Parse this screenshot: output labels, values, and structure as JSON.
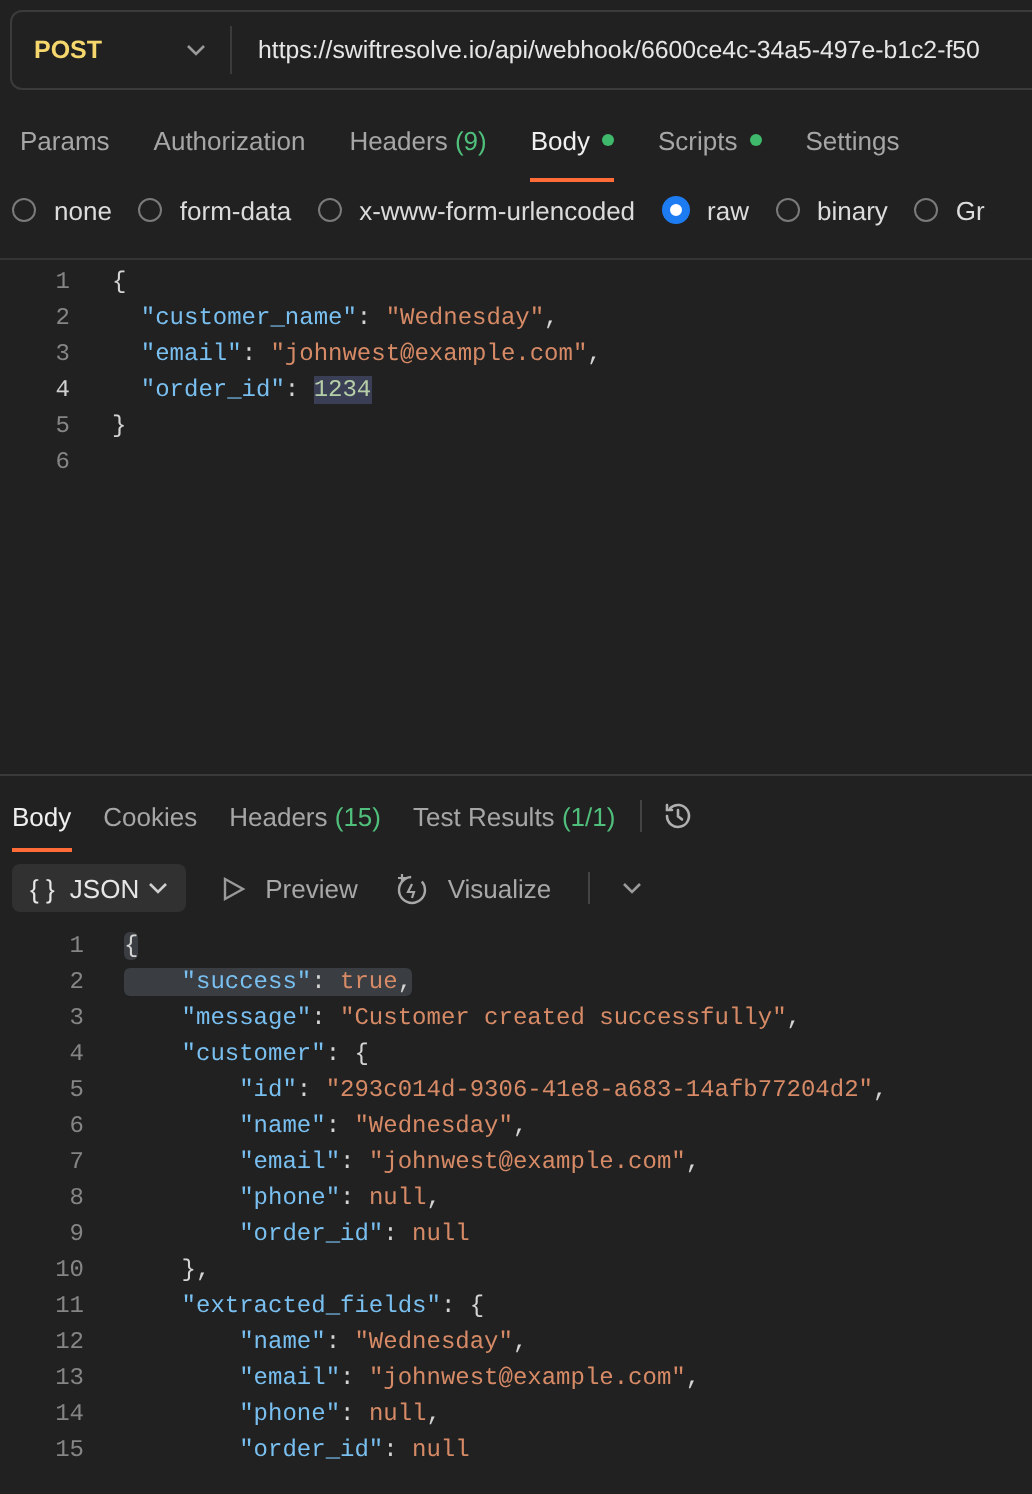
{
  "request_bar": {
    "method": "POST",
    "url": "https://swiftresolve.io/api/webhook/6600ce4c-34a5-497e-b1c2-f50"
  },
  "request_tabs": [
    {
      "label": "Params",
      "dot": false,
      "selected": false
    },
    {
      "label": "Authorization",
      "dot": false,
      "selected": false
    },
    {
      "label": "Headers",
      "count": "(9)",
      "dot": false,
      "selected": false
    },
    {
      "label": "Body",
      "dot": true,
      "selected": true
    },
    {
      "label": "Scripts",
      "dot": true,
      "selected": false
    },
    {
      "label": "Settings",
      "dot": false,
      "selected": false
    }
  ],
  "body_types": [
    {
      "label": "none",
      "selected": false
    },
    {
      "label": "form-data",
      "selected": false
    },
    {
      "label": "x-www-form-urlencoded",
      "selected": false
    },
    {
      "label": "raw",
      "selected": true
    },
    {
      "label": "binary",
      "selected": false
    },
    {
      "label": "Gr",
      "selected": false
    }
  ],
  "request_editor": {
    "lines": [
      {
        "number": "1",
        "selected": false,
        "tokens": [
          {
            "kind": "punct",
            "text": "{"
          }
        ]
      },
      {
        "number": "2",
        "selected": false,
        "tokens": [
          {
            "kind": "key",
            "text": "  \"customer_name\""
          },
          {
            "kind": "punct",
            "text": ": "
          },
          {
            "kind": "string",
            "text": "\"Wednesday\""
          },
          {
            "kind": "punct",
            "text": ","
          }
        ]
      },
      {
        "number": "3",
        "selected": false,
        "tokens": [
          {
            "kind": "key",
            "text": "  \"email\""
          },
          {
            "kind": "punct",
            "text": ": "
          },
          {
            "kind": "string",
            "text": "\"johnwest@example.com\""
          },
          {
            "kind": "punct",
            "text": ","
          }
        ]
      },
      {
        "number": "4",
        "selected": true,
        "tokens": [
          {
            "kind": "key",
            "text": "  \"order_id\""
          },
          {
            "kind": "punct",
            "text": ": "
          },
          {
            "kind": "number",
            "text": "1234"
          }
        ]
      },
      {
        "number": "5",
        "selected": false,
        "tokens": [
          {
            "kind": "punct",
            "text": "}"
          }
        ]
      },
      {
        "number": "6",
        "selected": false
      }
    ]
  },
  "response_tabs": [
    {
      "label": "Body",
      "selected": true
    },
    {
      "label": "Cookies",
      "selected": false
    },
    {
      "label": "Headers",
      "count": "(15)",
      "selected": false
    },
    {
      "label": "Test Results",
      "count": "(1/1)",
      "selected": false
    }
  ],
  "response_toolbar": {
    "format": {
      "icon": "{ }",
      "label": "JSON"
    },
    "preview": "Preview",
    "visualize": "Visualize"
  },
  "response_editor": {
    "lines": [
      {
        "number": "1",
        "selected": true,
        "tokens": [
          {
            "kind": "punct",
            "text": "{"
          }
        ]
      },
      {
        "number": "2",
        "selected": true,
        "tokens": [
          {
            "kind": "key",
            "text": "    \"success\""
          },
          {
            "kind": "punct",
            "text": ": "
          },
          {
            "kind": "bool",
            "text": "true"
          },
          {
            "kind": "punct",
            "text": ","
          }
        ]
      },
      {
        "number": "3",
        "selected": false,
        "tokens": [
          {
            "kind": "key",
            "text": "    \"message\""
          },
          {
            "kind": "punct",
            "text": ": "
          },
          {
            "kind": "string",
            "text": "\"Customer created successfully\""
          },
          {
            "kind": "punct",
            "text": ","
          }
        ]
      },
      {
        "number": "4",
        "selected": false,
        "tokens": [
          {
            "kind": "key",
            "text": "    \"customer\""
          },
          {
            "kind": "punct",
            "text": ": {"
          }
        ]
      },
      {
        "number": "5",
        "selected": false,
        "tokens": [
          {
            "kind": "key",
            "text": "        \"id\""
          },
          {
            "kind": "punct",
            "text": ": "
          },
          {
            "kind": "string",
            "text": "\"293c014d-9306-41e8-a683-14afb77204d2\""
          },
          {
            "kind": "punct",
            "text": ","
          }
        ]
      },
      {
        "number": "6",
        "selected": false,
        "tokens": [
          {
            "kind": "key",
            "text": "        \"name\""
          },
          {
            "kind": "punct",
            "text": ": "
          },
          {
            "kind": "string",
            "text": "\"Wednesday\""
          },
          {
            "kind": "punct",
            "text": ","
          }
        ]
      },
      {
        "number": "7",
        "selected": false,
        "tokens": [
          {
            "kind": "key",
            "text": "        \"email\""
          },
          {
            "kind": "punct",
            "text": ": "
          },
          {
            "kind": "string",
            "text": "\"johnwest@example.com\""
          },
          {
            "kind": "punct",
            "text": ","
          }
        ]
      },
      {
        "number": "8",
        "selected": false,
        "tokens": [
          {
            "kind": "key",
            "text": "        \"phone\""
          },
          {
            "kind": "punct",
            "text": ": "
          },
          {
            "kind": "null",
            "text": "null"
          },
          {
            "kind": "punct",
            "text": ","
          }
        ]
      },
      {
        "number": "9",
        "selected": false,
        "tokens": [
          {
            "kind": "key",
            "text": "        \"order_id\""
          },
          {
            "kind": "punct",
            "text": ": "
          },
          {
            "kind": "null",
            "text": "null"
          }
        ]
      },
      {
        "number": "10",
        "selected": false,
        "tokens": [
          {
            "kind": "punct",
            "text": "    },"
          }
        ]
      },
      {
        "number": "11",
        "selected": false,
        "tokens": [
          {
            "kind": "key",
            "text": "    \"extracted_fields\""
          },
          {
            "kind": "punct",
            "text": ": {"
          }
        ]
      },
      {
        "number": "12",
        "selected": false,
        "tokens": [
          {
            "kind": "key",
            "text": "        \"name\""
          },
          {
            "kind": "punct",
            "text": ": "
          },
          {
            "kind": "string",
            "text": "\"Wednesday\""
          },
          {
            "kind": "punct",
            "text": ","
          }
        ]
      },
      {
        "number": "13",
        "selected": false,
        "tokens": [
          {
            "kind": "key",
            "text": "        \"email\""
          },
          {
            "kind": "punct",
            "text": ": "
          },
          {
            "kind": "string",
            "text": "\"johnwest@example.com\""
          },
          {
            "kind": "punct",
            "text": ","
          }
        ]
      },
      {
        "number": "14",
        "selected": false,
        "tokens": [
          {
            "kind": "key",
            "text": "        \"phone\""
          },
          {
            "kind": "punct",
            "text": ": "
          },
          {
            "kind": "null",
            "text": "null"
          },
          {
            "kind": "punct",
            "text": ","
          }
        ]
      },
      {
        "number": "15",
        "selected": false,
        "tokens": [
          {
            "kind": "key",
            "text": "        \"order_id\""
          },
          {
            "kind": "punct",
            "text": ": "
          },
          {
            "kind": "null",
            "text": "null"
          }
        ]
      }
    ]
  }
}
